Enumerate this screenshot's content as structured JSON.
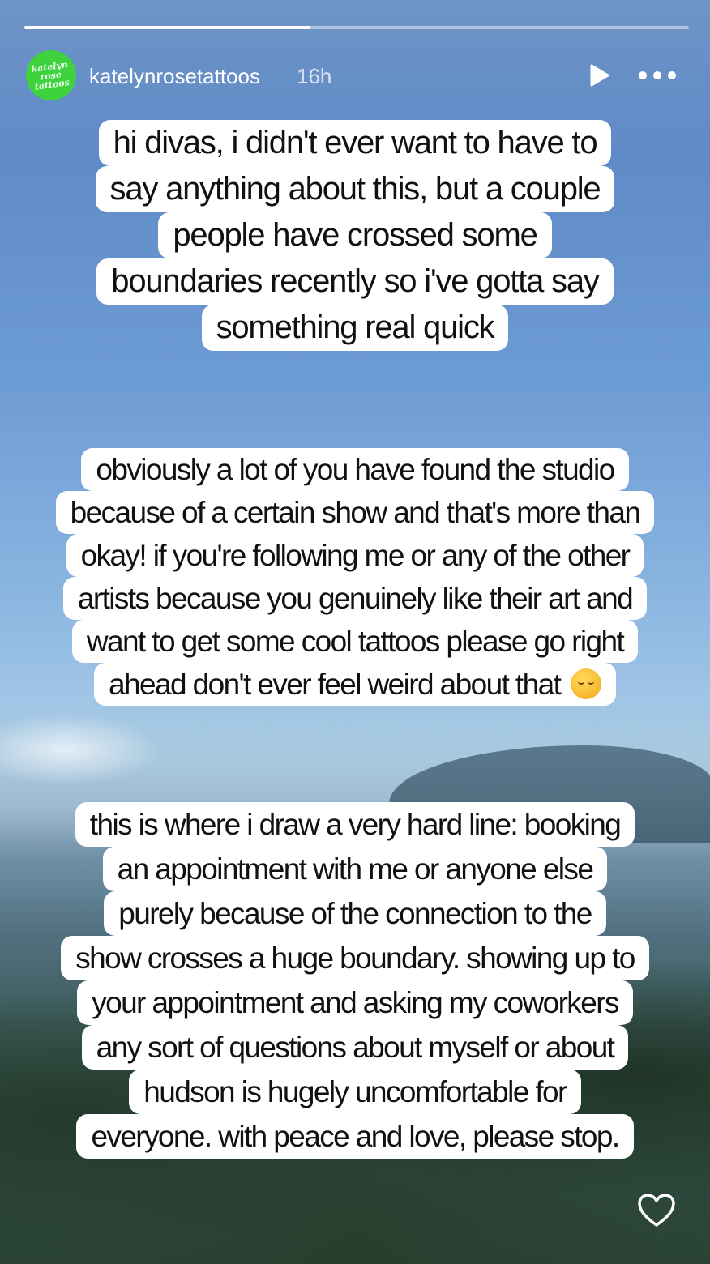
{
  "story": {
    "progress": 0.43,
    "username": "katelynrosetattoos",
    "time_ago": "16h",
    "avatar_text": [
      "katelyn",
      "rose",
      "tattoos"
    ]
  },
  "icons": {
    "play": "play-icon",
    "more": "more-options-icon",
    "like": "heart-icon",
    "emoji": "relieved-face-emoji"
  },
  "text_blocks": {
    "block1": [
      "hi divas, i didn't ever want to have to",
      "say anything about this, but a couple",
      "people have crossed some",
      "boundaries recently so i've gotta say",
      "something real quick"
    ],
    "block2": [
      "obviously a lot of you have found the studio",
      "because of a certain show and that's more than",
      "okay! if you're following me or any of the other",
      "artists because you genuinely like their art and",
      "want to get some cool tattoos please go right",
      "ahead don't ever feel weird about that"
    ],
    "block3": [
      "this is where i draw a very hard line: booking",
      "an appointment with me or anyone else",
      "purely because of the connection to the",
      "show crosses a huge boundary. showing up to",
      "your appointment and asking my coworkers",
      "any sort of questions about myself or about",
      "hudson is hugely uncomfortable for",
      "everyone. with peace and love, please stop."
    ]
  }
}
